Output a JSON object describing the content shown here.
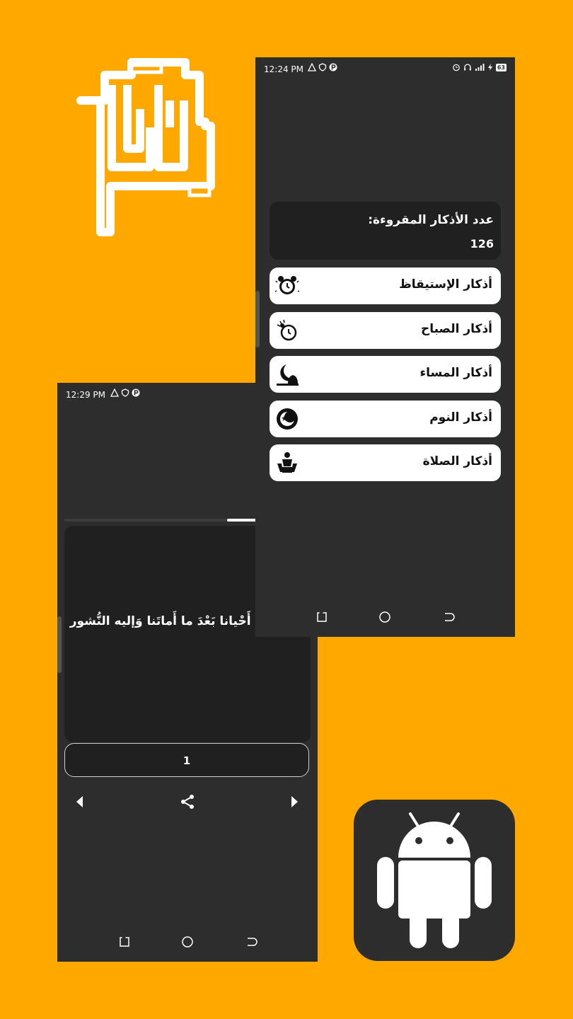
{
  "colors": {
    "background": "#FFA800",
    "screen": "#2d2d2d",
    "card": "#202020",
    "button": "#ffffff"
  },
  "logo": {
    "icon": "app-logo-icon"
  },
  "home_screen": {
    "status": {
      "time": "12:24 PM",
      "battery": "63"
    },
    "counter": {
      "label": "عدد الأذكار المقروءة:",
      "value": "126"
    },
    "items": [
      {
        "label": "أذكار الإستيقاظ",
        "icon": "alarm-clock-icon"
      },
      {
        "label": "أذكار الصباح",
        "icon": "morning-clock-icon"
      },
      {
        "label": "أذكار المساء",
        "icon": "crescent-mosque-icon"
      },
      {
        "label": "أذكار النوم",
        "icon": "moon-star-icon"
      },
      {
        "label": "أذكار الصلاة",
        "icon": "praying-person-icon"
      }
    ]
  },
  "reader_screen": {
    "status": {
      "time": "12:29 PM"
    },
    "progress": 0.12,
    "text": "الحمد لِلّهِ الّذي أَحْيانا بَعْدَ ما أَماتَنا وَإليه النُّشور",
    "count": "1"
  },
  "android_tile": {
    "icon": "android-icon"
  }
}
